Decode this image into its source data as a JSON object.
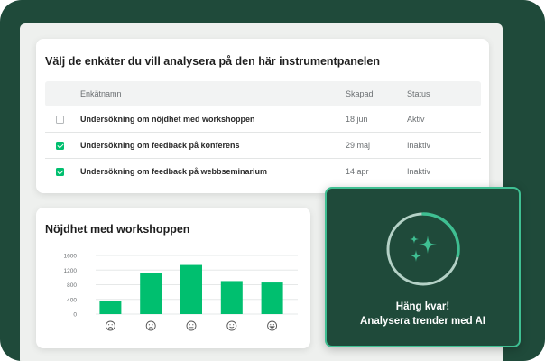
{
  "survey_selector": {
    "title": "Välj de enkäter du vill analysera på den här instrumentpanelen",
    "columns": [
      "Enkätnamn",
      "Skapad",
      "Status"
    ],
    "rows": [
      {
        "name": "Undersökning om nöjdhet med workshoppen",
        "created": "18 jun",
        "status": "Aktiv",
        "checked": false
      },
      {
        "name": "Undersökning om feedback på konferens",
        "created": "29 maj",
        "status": "Inaktiv",
        "checked": true
      },
      {
        "name": "Undersökning om feedback på webbseminarium",
        "created": "14 apr",
        "status": "Inaktiv",
        "checked": true
      }
    ]
  },
  "chart_card": {
    "title": "Nöjdhet med workshoppen"
  },
  "chart_data": {
    "type": "bar",
    "title": "Nöjdhet med workshoppen",
    "categories": [
      "very-dissatisfied-face-icon",
      "dissatisfied-face-icon",
      "neutral-face-icon",
      "satisfied-face-icon",
      "very-satisfied-face-icon"
    ],
    "values": [
      350,
      1130,
      1340,
      900,
      860
    ],
    "ylim": [
      0,
      1600
    ],
    "yticks": [
      "0",
      "400",
      "800",
      "1200",
      "1600"
    ],
    "grid": true,
    "bar_color": "#00bf6f"
  },
  "ai_card": {
    "line1": "Häng kvar!",
    "line2": "Analysera trender med AI",
    "progress": 0.28,
    "accent": "#3fbf92",
    "icon": "sparkles-icon"
  },
  "colors": {
    "brand_green": "#00bf6f",
    "dark_green": "#1f4a3a"
  }
}
